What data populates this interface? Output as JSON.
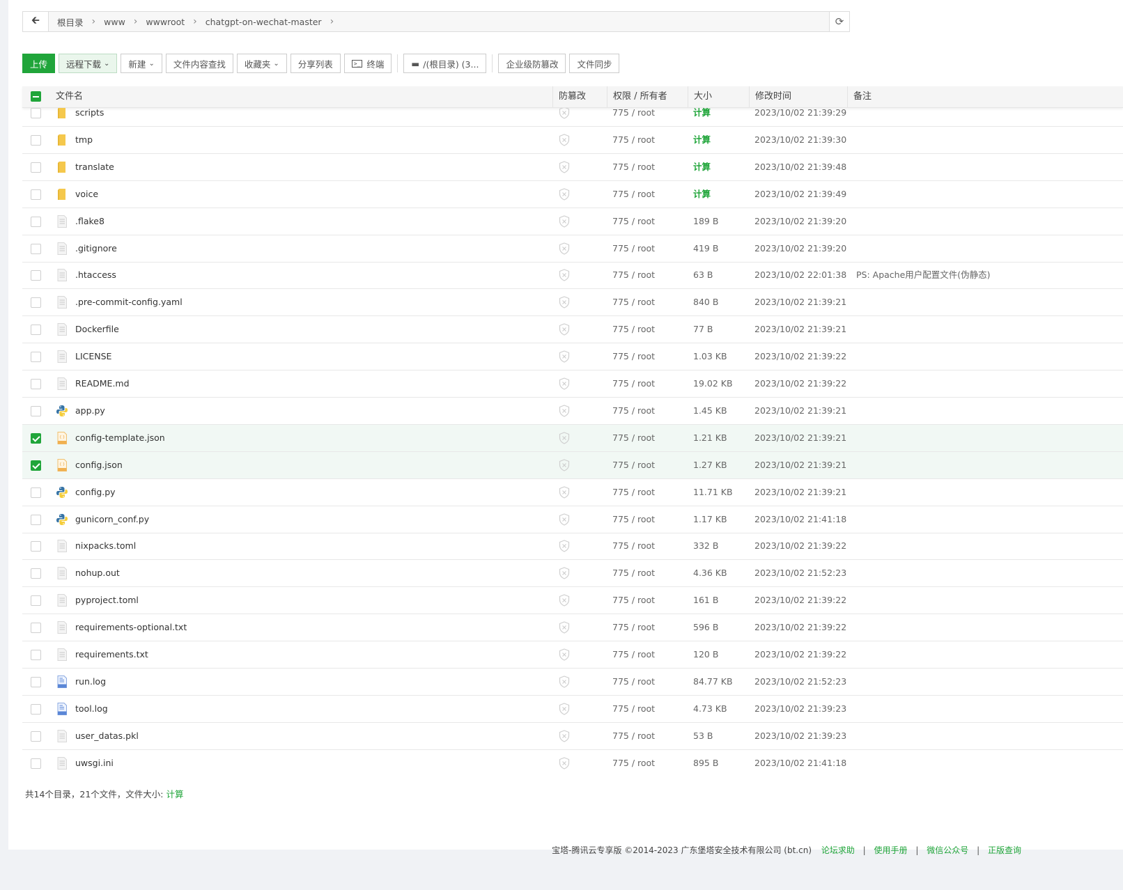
{
  "breadcrumb": {
    "items": [
      "根目录",
      "www",
      "wwwroot",
      "chatgpt-on-wechat-master"
    ]
  },
  "toolbar": {
    "upload": "上传",
    "remote_download": "远程下载",
    "new": "新建",
    "content_search": "文件内容查找",
    "favorites": "收藏夹",
    "share_list": "分享列表",
    "terminal": "终端",
    "disk": "/(根目录) (3...",
    "enterprise_tamper": "企业级防篡改",
    "file_sync": "文件同步"
  },
  "table": {
    "headers": {
      "name": "文件名",
      "tamper": "防篡改",
      "perm": "权限 / 所有者",
      "size": "大小",
      "mtime": "修改时间",
      "note": "备注"
    },
    "rows": [
      {
        "name": "scripts",
        "type": "folder",
        "perm": "775 / root",
        "size": "计算",
        "mtime": "2023/10/02 21:39:29",
        "note": "",
        "checked": false
      },
      {
        "name": "tmp",
        "type": "folder",
        "perm": "775 / root",
        "size": "计算",
        "mtime": "2023/10/02 21:39:30",
        "note": "",
        "checked": false
      },
      {
        "name": "translate",
        "type": "folder",
        "perm": "775 / root",
        "size": "计算",
        "mtime": "2023/10/02 21:39:48",
        "note": "",
        "checked": false
      },
      {
        "name": "voice",
        "type": "folder",
        "perm": "775 / root",
        "size": "计算",
        "mtime": "2023/10/02 21:39:49",
        "note": "",
        "checked": false
      },
      {
        "name": ".flake8",
        "type": "file",
        "perm": "775 / root",
        "size": "189 B",
        "mtime": "2023/10/02 21:39:20",
        "note": "",
        "checked": false
      },
      {
        "name": ".gitignore",
        "type": "file",
        "perm": "775 / root",
        "size": "419 B",
        "mtime": "2023/10/02 21:39:20",
        "note": "",
        "checked": false
      },
      {
        "name": ".htaccess",
        "type": "file",
        "perm": "775 / root",
        "size": "63 B",
        "mtime": "2023/10/02 22:01:38",
        "note": "PS: Apache用户配置文件(伪静态)",
        "checked": false
      },
      {
        "name": ".pre-commit-config.yaml",
        "type": "file",
        "perm": "775 / root",
        "size": "840 B",
        "mtime": "2023/10/02 21:39:21",
        "note": "",
        "checked": false
      },
      {
        "name": "Dockerfile",
        "type": "file",
        "perm": "775 / root",
        "size": "77 B",
        "mtime": "2023/10/02 21:39:21",
        "note": "",
        "checked": false
      },
      {
        "name": "LICENSE",
        "type": "file",
        "perm": "775 / root",
        "size": "1.03 KB",
        "mtime": "2023/10/02 21:39:22",
        "note": "",
        "checked": false
      },
      {
        "name": "README.md",
        "type": "file",
        "perm": "775 / root",
        "size": "19.02 KB",
        "mtime": "2023/10/02 21:39:22",
        "note": "",
        "checked": false
      },
      {
        "name": "app.py",
        "type": "python",
        "perm": "775 / root",
        "size": "1.45 KB",
        "mtime": "2023/10/02 21:39:21",
        "note": "",
        "checked": false
      },
      {
        "name": "config-template.json",
        "type": "json",
        "perm": "775 / root",
        "size": "1.21 KB",
        "mtime": "2023/10/02 21:39:21",
        "note": "",
        "checked": true
      },
      {
        "name": "config.json",
        "type": "json",
        "perm": "775 / root",
        "size": "1.27 KB",
        "mtime": "2023/10/02 21:39:21",
        "note": "",
        "checked": true
      },
      {
        "name": "config.py",
        "type": "python",
        "perm": "775 / root",
        "size": "11.71 KB",
        "mtime": "2023/10/02 21:39:21",
        "note": "",
        "checked": false
      },
      {
        "name": "gunicorn_conf.py",
        "type": "python",
        "perm": "775 / root",
        "size": "1.17 KB",
        "mtime": "2023/10/02 21:41:18",
        "note": "",
        "checked": false
      },
      {
        "name": "nixpacks.toml",
        "type": "file",
        "perm": "775 / root",
        "size": "332 B",
        "mtime": "2023/10/02 21:39:22",
        "note": "",
        "checked": false
      },
      {
        "name": "nohup.out",
        "type": "file",
        "perm": "775 / root",
        "size": "4.36 KB",
        "mtime": "2023/10/02 21:52:23",
        "note": "",
        "checked": false
      },
      {
        "name": "pyproject.toml",
        "type": "file",
        "perm": "775 / root",
        "size": "161 B",
        "mtime": "2023/10/02 21:39:22",
        "note": "",
        "checked": false
      },
      {
        "name": "requirements-optional.txt",
        "type": "file",
        "perm": "775 / root",
        "size": "596 B",
        "mtime": "2023/10/02 21:39:22",
        "note": "",
        "checked": false
      },
      {
        "name": "requirements.txt",
        "type": "file",
        "perm": "775 / root",
        "size": "120 B",
        "mtime": "2023/10/02 21:39:22",
        "note": "",
        "checked": false
      },
      {
        "name": "run.log",
        "type": "log",
        "perm": "775 / root",
        "size": "84.77 KB",
        "mtime": "2023/10/02 21:52:23",
        "note": "",
        "checked": false
      },
      {
        "name": "tool.log",
        "type": "log",
        "perm": "775 / root",
        "size": "4.73 KB",
        "mtime": "2023/10/02 21:39:23",
        "note": "",
        "checked": false
      },
      {
        "name": "user_datas.pkl",
        "type": "file",
        "perm": "775 / root",
        "size": "53 B",
        "mtime": "2023/10/02 21:39:23",
        "note": "",
        "checked": false
      },
      {
        "name": "uwsgi.ini",
        "type": "file",
        "perm": "775 / root",
        "size": "895 B",
        "mtime": "2023/10/02 21:41:18",
        "note": "",
        "checked": false
      }
    ]
  },
  "summary": {
    "text": "共14个目录，21个文件，文件大小: ",
    "calc": "计算"
  },
  "footer": {
    "copyright": "宝塔-腾讯云专享版 ©2014-2023 广东堡塔安全技术有限公司 (bt.cn)",
    "links": [
      "论坛求助",
      "使用手册",
      "微信公众号",
      "正版查询"
    ],
    "separator": "|"
  },
  "colors": {
    "accent": "#20a53a",
    "selected_row": "#f1f8f4",
    "folder": "#f5c84c"
  }
}
